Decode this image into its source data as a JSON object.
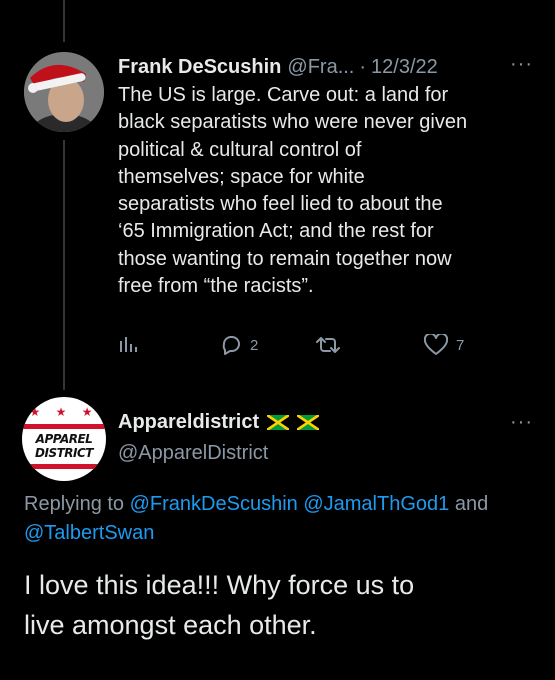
{
  "tweet1": {
    "display_name": "Frank DeScushin",
    "handle": "@Fra...",
    "separator": "·",
    "date": "12/3/22",
    "more": "···",
    "text": "The US is large. Carve out: a land for\nblack separatists who were never given\npolitical & cultural control of\nthemselves; space for white\nseparatists who feel lied to about the\n‘65 Immigration Act; and the rest for\nthose wanting to remain together now\nfree from “the racists”.",
    "actions": {
      "analytics_icon": "analytics-icon",
      "reply_icon": "reply-icon",
      "reply_count": "2",
      "retweet_icon": "retweet-icon",
      "like_icon": "like-icon",
      "like_count": "7"
    }
  },
  "tweet2": {
    "display_name": "Appareldistrict",
    "flags": [
      "jamaica-flag-icon",
      "jamaica-flag-icon"
    ],
    "handle": "@ApparelDistrict",
    "more": "···",
    "avatar_text_line1": "APPAREL",
    "avatar_text_line2": "DISTRICT",
    "avatar_stars": "★ ★ ★",
    "reply_prefix": "Replying to",
    "reply_to_1": "@FrankDeScushin",
    "reply_to_2": "@JamalThGod1",
    "reply_and": "and",
    "reply_to_3": "@TalbertSwan",
    "text": "I love this idea!!! Why force us to\nlive amongst each other."
  },
  "colors": {
    "background": "#000000",
    "text": "#e7e9ea",
    "muted": "#8b98a5",
    "link": "#1d9bf0",
    "thread_line": "#333639"
  }
}
